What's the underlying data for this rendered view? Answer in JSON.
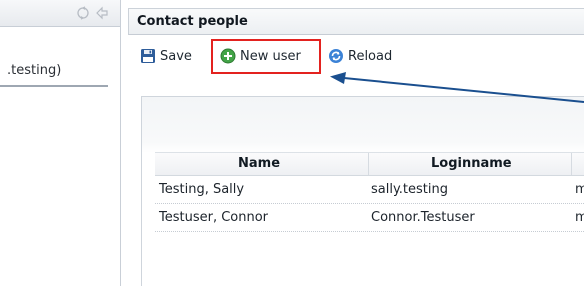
{
  "left_panel": {
    "item_text": ".testing)",
    "icons": [
      "refresh-icon",
      "back-arrow-icon"
    ]
  },
  "main": {
    "title": "Contact people",
    "toolbar": {
      "save_label": "Save",
      "new_user_label": "New user",
      "reload_label": "Reload"
    },
    "table": {
      "columns": [
        "Name",
        "Loginname"
      ],
      "rows": [
        {
          "name": "Testing, Sally",
          "login": "sally.testing",
          "extra": "m"
        },
        {
          "name": "Testuser, Connor",
          "login": "Connor.Testuser",
          "extra": "m"
        }
      ]
    }
  },
  "colors": {
    "highlight": "#e3221f",
    "arrow": "#1a4f8f"
  }
}
